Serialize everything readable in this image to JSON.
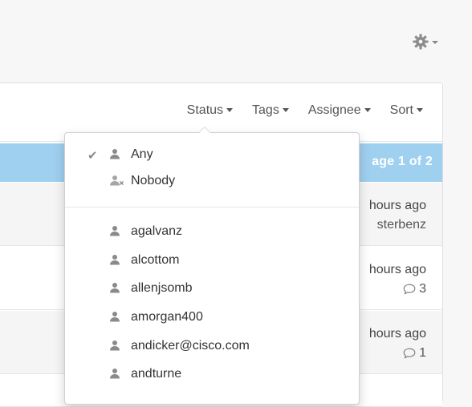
{
  "gear": {
    "icon": "gear-icon"
  },
  "filters": {
    "status": "Status",
    "tags": "Tags",
    "assignee": "Assignee",
    "sort": "Sort"
  },
  "pagination": {
    "label": "age 1 of 2"
  },
  "rows": [
    {
      "time": "hours ago",
      "meta": "sterbenz"
    },
    {
      "time": "hours ago",
      "comments": "3"
    },
    {
      "time": "hours ago",
      "comments": "1"
    }
  ],
  "assignee_menu": {
    "any": "Any",
    "nobody": "Nobody",
    "users": [
      "agalvanz",
      "alcottom",
      "allenjsomb",
      "amorgan400",
      "andicker@cisco.com",
      "andturne"
    ]
  },
  "colors": {
    "accent_blue": "#9fd0ef",
    "icon_gray": "#8a8a8a"
  }
}
